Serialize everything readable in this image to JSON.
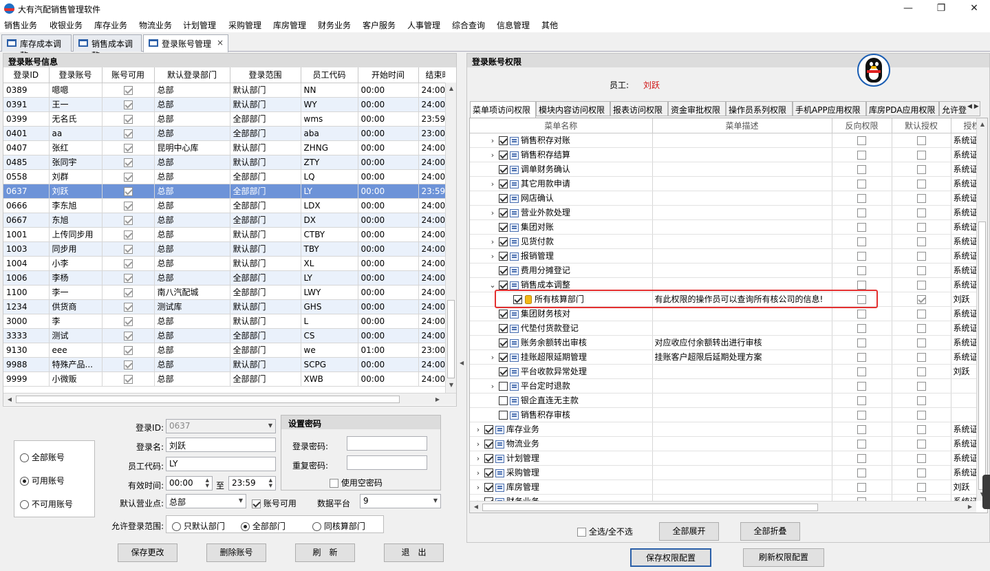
{
  "app": {
    "title": "大有汽配销售管理软件"
  },
  "window": {
    "minimize": "—",
    "restore": "❐",
    "close": "✕"
  },
  "menu": [
    "销售业务",
    "收银业务",
    "库存业务",
    "物流业务",
    "计划管理",
    "采购管理",
    "库房管理",
    "财务业务",
    "客户服务",
    "人事管理",
    "综合查询",
    "信息管理",
    "其他"
  ],
  "doc_tabs": [
    {
      "label": "库存成本调整"
    },
    {
      "label": "销售成本调整"
    },
    {
      "label": "登录账号管理"
    }
  ],
  "doc_tab_close": "×",
  "left": {
    "title": "登录账号信息",
    "columns": [
      "登录ID",
      "登录账号",
      "账号可用",
      "默认登录部门",
      "登录范围",
      "员工代码",
      "开始时间",
      "结束时"
    ],
    "rows": [
      [
        "0389",
        "嗯嗯",
        true,
        "总部",
        "默认部门",
        "NN",
        "00:00",
        "24:00"
      ],
      [
        "0391",
        "王一",
        true,
        "总部",
        "默认部门",
        "WY",
        "00:00",
        "24:00"
      ],
      [
        "0399",
        "无名氏",
        true,
        "总部",
        "全部部门",
        "wms",
        "00:00",
        "23:59"
      ],
      [
        "0401",
        "aa",
        true,
        "总部",
        "全部部门",
        "aba",
        "00:00",
        "23:00"
      ],
      [
        "0407",
        "张红",
        true,
        "昆明中心库",
        "默认部门",
        "ZHNG",
        "00:00",
        "24:00"
      ],
      [
        "0485",
        "张同宇",
        true,
        "总部",
        "默认部门",
        "ZTY",
        "00:00",
        "24:00"
      ],
      [
        "0558",
        "刘群",
        true,
        "总部",
        "全部部门",
        "LQ",
        "00:00",
        "24:00"
      ],
      [
        "0637",
        "刘跃",
        true,
        "总部",
        "全部部门",
        "LY",
        "00:00",
        "23:59"
      ],
      [
        "0666",
        "李东旭",
        true,
        "总部",
        "全部部门",
        "LDX",
        "00:00",
        "24:00"
      ],
      [
        "0667",
        "东旭",
        true,
        "总部",
        "全部部门",
        "DX",
        "00:00",
        "24:00"
      ],
      [
        "1001",
        "上传同步用",
        true,
        "总部",
        "默认部门",
        "CTBY",
        "00:00",
        "24:00"
      ],
      [
        "1003",
        "同步用",
        true,
        "总部",
        "默认部门",
        "TBY",
        "00:00",
        "24:00"
      ],
      [
        "1004",
        "小李",
        true,
        "总部",
        "默认部门",
        "XL",
        "00:00",
        "24:00"
      ],
      [
        "1006",
        "李杨",
        true,
        "总部",
        "全部部门",
        "LY",
        "00:00",
        "24:00"
      ],
      [
        "1100",
        "李一",
        true,
        "南八汽配城",
        "全部部门",
        "LWY",
        "00:00",
        "24:00"
      ],
      [
        "1234",
        "供货商",
        true,
        "测试库",
        "默认部门",
        "GHS",
        "00:00",
        "24:00"
      ],
      [
        "3000",
        "李",
        true,
        "总部",
        "默认部门",
        "L",
        "00:00",
        "24:00"
      ],
      [
        "3333",
        "测试",
        true,
        "总部",
        "全部部门",
        "CS",
        "00:00",
        "24:00"
      ],
      [
        "9130",
        "eee",
        true,
        "总部",
        "全部部门",
        "we",
        "01:00",
        "23:00"
      ],
      [
        "9988",
        "特殊产品...",
        true,
        "总部",
        "默认部门",
        "SCPG",
        "00:00",
        "24:00"
      ],
      [
        "9999",
        "小微贩",
        true,
        "总部",
        "全部部门",
        "XWB",
        "00:00",
        "24:00"
      ]
    ],
    "selected_index": 7
  },
  "filter": {
    "options": [
      "全部账号",
      "可用账号",
      "不可用账号"
    ],
    "selected": 1
  },
  "form": {
    "login_id_label": "登录ID:",
    "login_id": "0637",
    "login_name_label": "登录名:",
    "login_name": "刘跃",
    "emp_code_label": "员工代码:",
    "emp_code": "LY",
    "valid_time_label": "有效时间:",
    "start": "00:00",
    "to": "至",
    "end": "23:59",
    "default_point_label": "默认营业点:",
    "default_point": "总部",
    "enabled_label": "账号可用",
    "platform_label": "数据平台",
    "platform": "9",
    "scope_label": "允许登录范围:",
    "scope_options": [
      "只默认部门",
      "全部部门",
      "同核算部门"
    ],
    "scope_selected": 1
  },
  "password": {
    "title": "设置密码",
    "pwd_label": "登录密码:",
    "repeat_label": "重复密码:",
    "empty_label": "使用空密码"
  },
  "left_buttons": [
    "保存更改",
    "删除账号",
    "刷　新",
    "退　出"
  ],
  "right": {
    "title": "登录账号权限",
    "employee_label": "员工:",
    "employee": "刘跃",
    "tabs": [
      "菜单项访问权限",
      "模块内容访问权限",
      "报表访问权限",
      "资金审批权限",
      "操作员系列权限",
      "手机APP应用权限",
      "库房PDA应用权限",
      "允许登"
    ],
    "columns": [
      "菜单名称",
      "菜单描述",
      "反向权限",
      "默认授权",
      "授权"
    ],
    "rows": [
      {
        "level": 1,
        "exp": "›",
        "checked": true,
        "name": "销售积存对账",
        "desc": "",
        "rev": false,
        "def": false,
        "by": "系统证"
      },
      {
        "level": 1,
        "exp": "›",
        "checked": true,
        "name": "销售积存结算",
        "desc": "",
        "rev": false,
        "def": false,
        "by": "系统证"
      },
      {
        "level": 1,
        "exp": "",
        "checked": true,
        "name": "调单财务确认",
        "desc": "",
        "rev": false,
        "def": false,
        "by": "系统证"
      },
      {
        "level": 1,
        "exp": "›",
        "checked": true,
        "name": "其它用款申请",
        "desc": "",
        "rev": false,
        "def": false,
        "by": "系统证"
      },
      {
        "level": 1,
        "exp": "",
        "checked": true,
        "name": "网店确认",
        "desc": "",
        "rev": false,
        "def": false,
        "by": "系统证"
      },
      {
        "level": 1,
        "exp": "›",
        "checked": true,
        "name": "营业外款处理",
        "desc": "",
        "rev": false,
        "def": false,
        "by": "系统证"
      },
      {
        "level": 1,
        "exp": "",
        "checked": true,
        "name": "集团对账",
        "desc": "",
        "rev": false,
        "def": false,
        "by": "系统证"
      },
      {
        "level": 1,
        "exp": "›",
        "checked": true,
        "name": "见货付款",
        "desc": "",
        "rev": false,
        "def": false,
        "by": "系统证"
      },
      {
        "level": 1,
        "exp": "›",
        "checked": true,
        "name": "报销管理",
        "desc": "",
        "rev": false,
        "def": false,
        "by": "系统证"
      },
      {
        "level": 1,
        "exp": "",
        "checked": true,
        "name": "费用分摊登记",
        "desc": "",
        "rev": false,
        "def": false,
        "by": "系统证"
      },
      {
        "level": 1,
        "exp": "⌄",
        "checked": true,
        "name": "销售成本调整",
        "desc": "",
        "rev": false,
        "def": false,
        "by": "系统证"
      },
      {
        "level": 2,
        "exp": "",
        "checked": true,
        "name": "所有核算部门",
        "desc": "有此权限的操作员可以查询所有核公司的信息!",
        "rev": false,
        "def": true,
        "by": "刘跃",
        "leaf": true
      },
      {
        "level": 1,
        "exp": "",
        "checked": true,
        "name": "集团财务核对",
        "desc": "",
        "rev": false,
        "def": false,
        "by": "系统证"
      },
      {
        "level": 1,
        "exp": "",
        "checked": true,
        "name": "代垫付货款登记",
        "desc": "",
        "rev": false,
        "def": false,
        "by": "系统证"
      },
      {
        "level": 1,
        "exp": "",
        "checked": true,
        "name": "账务余额转出审核",
        "desc": "对应收应付余额转出进行审核",
        "rev": false,
        "def": false,
        "by": "系统证"
      },
      {
        "level": 1,
        "exp": "›",
        "checked": true,
        "name": "挂账超限延期管理",
        "desc": "挂账客户超限后延期处理方案",
        "rev": false,
        "def": false,
        "by": "系统证"
      },
      {
        "level": 1,
        "exp": "",
        "checked": true,
        "name": "平台收款异常处理",
        "desc": "",
        "rev": false,
        "def": false,
        "by": "刘跃"
      },
      {
        "level": 1,
        "exp": "›",
        "checked": false,
        "name": "平台定时退款",
        "desc": "",
        "rev": false,
        "def": false,
        "by": ""
      },
      {
        "level": 1,
        "exp": "",
        "checked": false,
        "name": "银企直连无主款",
        "desc": "",
        "rev": false,
        "def": false,
        "by": ""
      },
      {
        "level": 1,
        "exp": "",
        "checked": false,
        "name": "销售积存审核",
        "desc": "",
        "rev": false,
        "def": false,
        "by": ""
      },
      {
        "level": 0,
        "exp": "›",
        "checked": true,
        "name": "库存业务",
        "desc": "",
        "rev": false,
        "def": false,
        "by": "系统证"
      },
      {
        "level": 0,
        "exp": "›",
        "checked": true,
        "name": "物流业务",
        "desc": "",
        "rev": false,
        "def": false,
        "by": "系统证"
      },
      {
        "level": 0,
        "exp": "›",
        "checked": true,
        "name": "计划管理",
        "desc": "",
        "rev": false,
        "def": false,
        "by": "系统证"
      },
      {
        "level": 0,
        "exp": "›",
        "checked": true,
        "name": "采购管理",
        "desc": "",
        "rev": false,
        "def": false,
        "by": "系统证"
      },
      {
        "level": 0,
        "exp": "›",
        "checked": true,
        "name": "库房管理",
        "desc": "",
        "rev": false,
        "def": false,
        "by": "刘跃"
      },
      {
        "level": 0,
        "exp": "›",
        "checked": true,
        "name": "财务业务",
        "desc": "",
        "rev": false,
        "def": false,
        "by": "系统证"
      }
    ],
    "select_all_label": "全选/全不选",
    "expand_all": "全部展开",
    "collapse_all": "全部折叠",
    "save_btn": "保存权限配置",
    "refresh_btn": "刷新权限配置"
  }
}
